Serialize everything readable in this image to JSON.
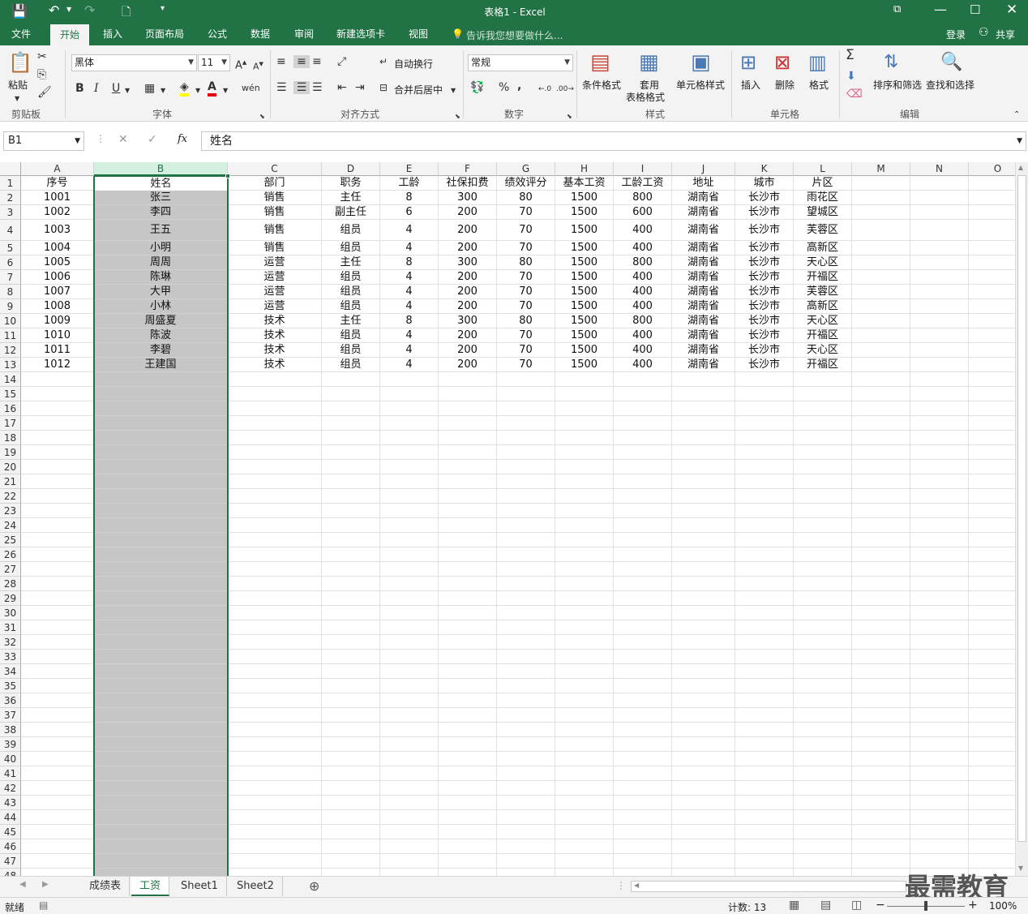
{
  "title": "表格1 - Excel",
  "menu_tabs": [
    "文件",
    "开始",
    "插入",
    "页面布局",
    "公式",
    "数据",
    "审阅",
    "新建选项卡",
    "视图"
  ],
  "tell_me": "告诉我您想要做什么...",
  "login": "登录",
  "share": "共享",
  "ribbon": {
    "paste": "粘贴",
    "font_name": "黑体",
    "font_size": "11",
    "wrap_text": "自动换行",
    "merge_center": "合并后居中",
    "number_format": "常规",
    "conditional_format": "条件格式",
    "table_format_1": "套用",
    "table_format_2": "表格格式",
    "cell_style": "单元格样式",
    "insert": "插入",
    "delete": "删除",
    "format": "格式",
    "sort_filter": "排序和筛选",
    "find_select": "查找和选择",
    "groups": [
      "剪贴板",
      "字体",
      "对齐方式",
      "数字",
      "样式",
      "单元格",
      "编辑"
    ]
  },
  "name_box": "B1",
  "formula": "姓名",
  "columns": [
    "A",
    "B",
    "C",
    "D",
    "E",
    "F",
    "G",
    "H",
    "I",
    "J",
    "K",
    "L",
    "M",
    "N",
    "O"
  ],
  "headers": [
    "序号",
    "姓名",
    "部门",
    "职务",
    "工龄",
    "社保扣费",
    "绩效评分",
    "基本工资",
    "工龄工资",
    "地址",
    "城市",
    "片区"
  ],
  "rows": [
    [
      "1001",
      "张三",
      "销售",
      "主任",
      "8",
      "300",
      "80",
      "1500",
      "800",
      "湖南省",
      "长沙市",
      "雨花区"
    ],
    [
      "1002",
      "李四",
      "销售",
      "副主任",
      "6",
      "200",
      "70",
      "1500",
      "600",
      "湖南省",
      "长沙市",
      "望城区"
    ],
    [
      "1003",
      "王五",
      "销售",
      "组员",
      "4",
      "200",
      "70",
      "1500",
      "400",
      "湖南省",
      "长沙市",
      "芙蓉区"
    ],
    [
      "1004",
      "小明",
      "销售",
      "组员",
      "4",
      "200",
      "70",
      "1500",
      "400",
      "湖南省",
      "长沙市",
      "高新区"
    ],
    [
      "1005",
      "周周",
      "运营",
      "主任",
      "8",
      "300",
      "80",
      "1500",
      "800",
      "湖南省",
      "长沙市",
      "天心区"
    ],
    [
      "1006",
      "陈琳",
      "运营",
      "组员",
      "4",
      "200",
      "70",
      "1500",
      "400",
      "湖南省",
      "长沙市",
      "开福区"
    ],
    [
      "1007",
      "大甲",
      "运营",
      "组员",
      "4",
      "200",
      "70",
      "1500",
      "400",
      "湖南省",
      "长沙市",
      "芙蓉区"
    ],
    [
      "1008",
      "小林",
      "运营",
      "组员",
      "4",
      "200",
      "70",
      "1500",
      "400",
      "湖南省",
      "长沙市",
      "高新区"
    ],
    [
      "1009",
      "周盛夏",
      "技术",
      "主任",
      "8",
      "300",
      "80",
      "1500",
      "800",
      "湖南省",
      "长沙市",
      "天心区"
    ],
    [
      "1010",
      "陈波",
      "技术",
      "组员",
      "4",
      "200",
      "70",
      "1500",
      "400",
      "湖南省",
      "长沙市",
      "开福区"
    ],
    [
      "1011",
      "李碧",
      "技术",
      "组员",
      "4",
      "200",
      "70",
      "1500",
      "400",
      "湖南省",
      "长沙市",
      "天心区"
    ],
    [
      "1012",
      "王建国",
      "技术",
      "组员",
      "4",
      "200",
      "70",
      "1500",
      "400",
      "湖南省",
      "长沙市",
      "开福区"
    ]
  ],
  "sheets": [
    "成绩表",
    "工资",
    "Sheet1",
    "Sheet2"
  ],
  "active_sheet": "工资",
  "status": {
    "ready": "就绪",
    "count": "计数: 13",
    "zoom": "100%"
  },
  "watermark": "最需教育",
  "colors": {
    "accent": "#217346",
    "selection": "#c6c6c6"
  }
}
